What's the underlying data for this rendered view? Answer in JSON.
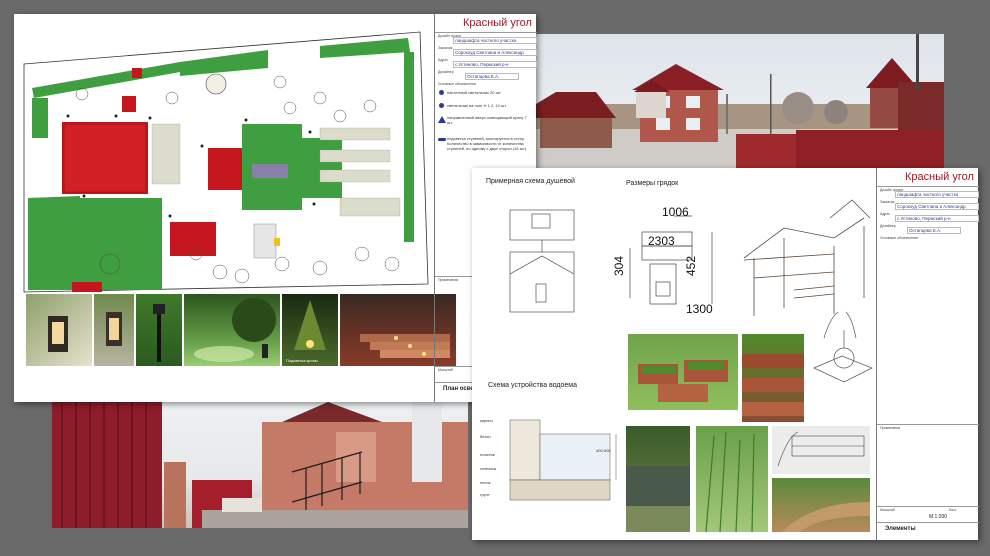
{
  "plan_sheet": {
    "title": "Красный угол",
    "fields": [
      {
        "label": "Дизайн проект",
        "value": "ландшафта частного участка"
      },
      {
        "label": "Заказчик",
        "value": "Сорокоуд Светлана и Александр"
      },
      {
        "label": "Адрес",
        "value": "с.Устиново, Пермский р-н"
      },
      {
        "label": "Дизайнер",
        "value": "Остапцева Е.А."
      }
    ],
    "legend_title": "Условные обозначения",
    "legend": [
      "настенный светильник 20 шт.",
      "светильник на ноге H 1.2, 12 шт.",
      "направленный вверх,освещающий крону 7 шт.",
      "подсветка ступеней, монтируется в стену. Количество в зависимости от количества ступеней, по одному с двух сторон (16 шт)"
    ],
    "notes_label": "Примечания",
    "scale_label": "Масштаб",
    "sheet_name": "План освещ",
    "photo_caption": "Подсветка кроны"
  },
  "elements_sheet": {
    "title": "Красный угол",
    "fields": [
      {
        "label": "Дизайн проект",
        "value": "ландшафта частного участка"
      },
      {
        "label": "Заказчик",
        "value": "Сорокоуд Светлана и Александр"
      },
      {
        "label": "Адрес",
        "value": "с.Устиново, Пермский р-н"
      },
      {
        "label": "Дизайнер",
        "value": "Остапцева Е.А."
      }
    ],
    "legend_title": "Условные обозначения",
    "notes_label": "Примечания",
    "scale_label": "Масштаб",
    "sheet_label": "Лист",
    "scale_value": "М 1:200",
    "sheet_name": "Элементы",
    "shower_title": "Примерная схема душевой",
    "beds_title": "Размеры грядок",
    "pond_title": "Схема устройства водоема",
    "dims": {
      "d1006": "1006",
      "d2303": "2303",
      "d304": "304",
      "d452": "452",
      "d1300": "1300"
    },
    "pond_layers": [
      "кирпич",
      "бетон",
      "пластик",
      "галечник",
      "песок",
      "грунт"
    ],
    "pond_depth": "400-500"
  },
  "colors": {
    "accent_red": "#9a1b27",
    "field_blue": "#2b3990",
    "lawn": "#3f9e3f",
    "roof": "#c4161c"
  }
}
